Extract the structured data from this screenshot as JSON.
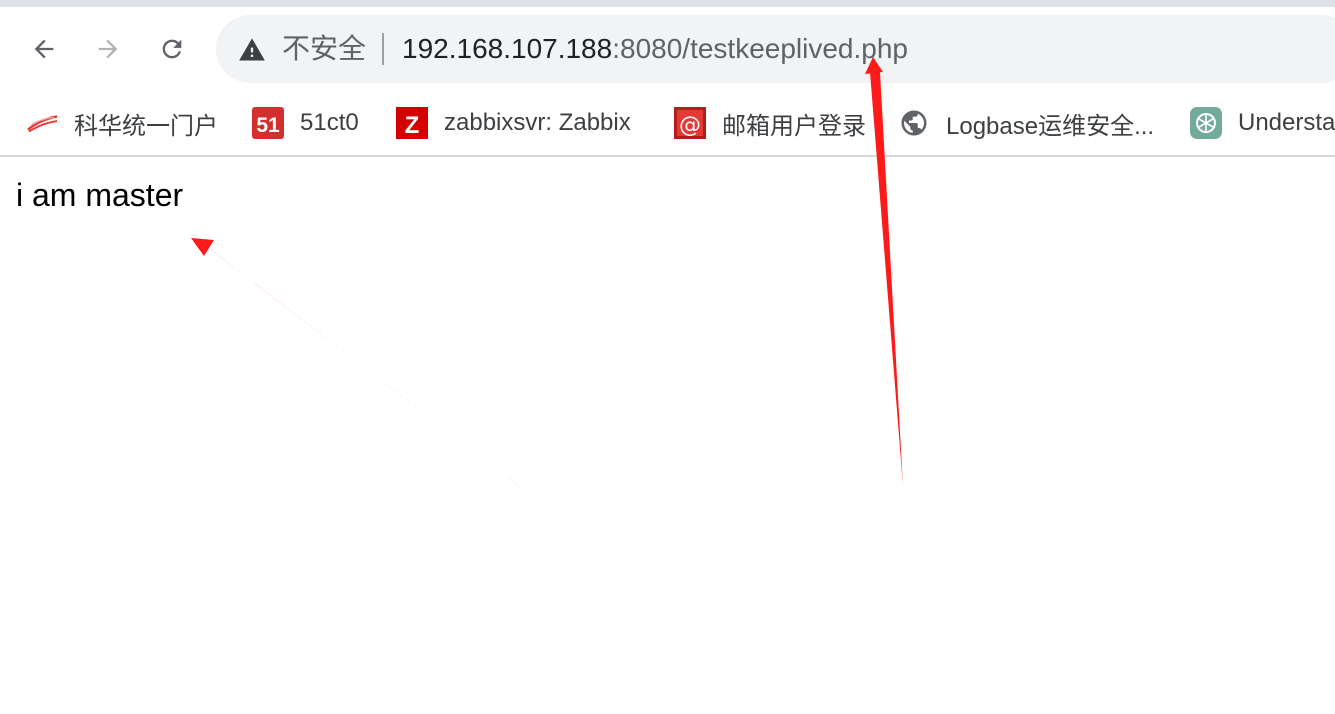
{
  "toolbar": {
    "back_icon": "arrow-left-icon",
    "forward_icon": "arrow-right-icon",
    "reload_icon": "reload-icon"
  },
  "address_bar": {
    "security_icon": "warning-triangle-icon",
    "security_label": "不安全",
    "url_host": "192.168.107.188",
    "url_rest": ":8080/testkeeplived.php"
  },
  "bookmarks": [
    {
      "label": "科华统一门户",
      "icon": "kehua-logo-icon",
      "color": "#e53935"
    },
    {
      "label": "51ct0",
      "icon": "51cto-logo-icon",
      "color": "#d32f2f"
    },
    {
      "label": "zabbixsvr: Zabbix",
      "icon": "zabbix-logo-icon",
      "color": "#d40000"
    },
    {
      "label": "邮箱用户登录",
      "icon": "mail-at-icon",
      "color": "#b71c1c"
    },
    {
      "label": "Logbase运维安全...",
      "icon": "globe-icon",
      "color": "#5f6368"
    },
    {
      "label": "Understa",
      "icon": "openai-logo-icon",
      "color": "#74aa9c"
    }
  ],
  "page": {
    "text": "i am master"
  },
  "annotations": {
    "arrow_color": "#ff1a1a"
  }
}
